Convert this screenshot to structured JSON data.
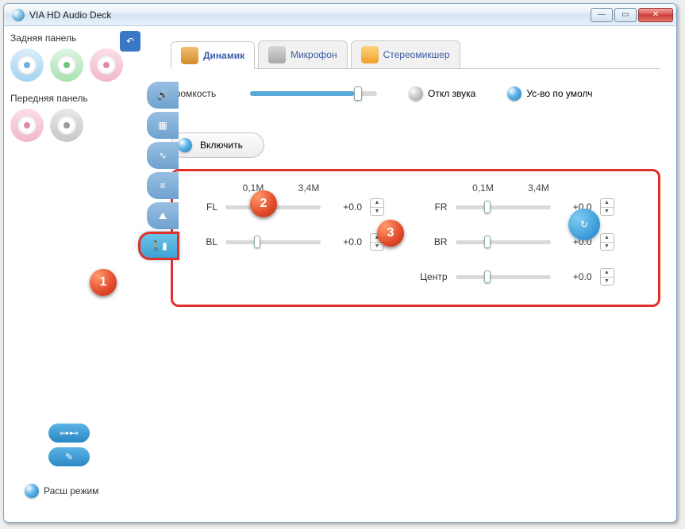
{
  "window": {
    "title": "VIA HD Audio Deck"
  },
  "left": {
    "back_label": "Задняя панель",
    "front_label": "Передняя панель",
    "mode_label": "Расш режим"
  },
  "tabs": {
    "speaker": "Динамик",
    "mic": "Микрофон",
    "mixer": "Стереомикшер"
  },
  "volume": {
    "label": "Громкость",
    "mute": "Откл звука",
    "default_dev": "Ус-во по умолч"
  },
  "enable": {
    "label": "Включить"
  },
  "scale": {
    "min": "0,1M",
    "max": "3,4M"
  },
  "channels": {
    "left": [
      {
        "name": "FL",
        "value_text": "+0.0",
        "pos": 30
      },
      {
        "name": "BL",
        "value_text": "+0.0",
        "pos": 30
      }
    ],
    "right": [
      {
        "name": "FR",
        "value_text": "+0.0",
        "pos": 30
      },
      {
        "name": "BR",
        "value_text": "+0.0",
        "pos": 30
      },
      {
        "name": "Центр",
        "value_text": "+0.0",
        "pos": 30
      }
    ]
  },
  "markers": {
    "m1": "1",
    "m2": "2",
    "m3": "3"
  }
}
